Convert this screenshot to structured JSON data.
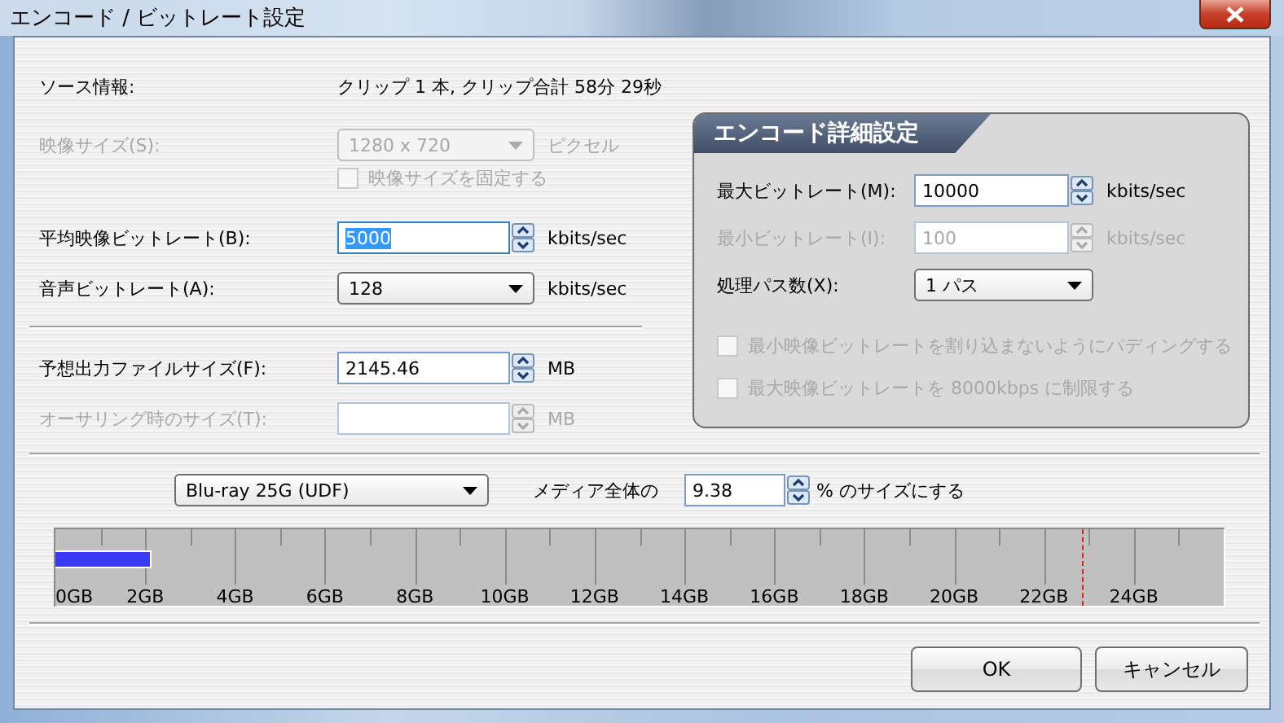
{
  "window": {
    "title": "エンコード / ビットレート設定"
  },
  "source_info": {
    "label": "ソース情報:",
    "value": "クリップ 1 本, クリップ合計 58分 29秒"
  },
  "fields": [
    {
      "kind": "combo",
      "label": "映像サイズ(S):",
      "value": "1280 x 720",
      "unit": "ピクセル",
      "disabled": true
    },
    {
      "kind": "checkbox",
      "label": "映像サイズを固定する",
      "checked": false,
      "disabled": true
    },
    {
      "kind": "spin",
      "label": "平均映像ビットレート(B):",
      "value": "5000",
      "unit": "kbits/sec",
      "disabled": false,
      "focused": true
    },
    {
      "kind": "combo",
      "label": "音声ビットレート(A):",
      "value": "128",
      "unit": "kbits/sec",
      "disabled": false
    },
    {
      "kind": "separator"
    },
    {
      "kind": "spin",
      "label": "予想出力ファイルサイズ(F):",
      "value": "2145.46",
      "unit": "MB",
      "disabled": false,
      "focused": false
    },
    {
      "kind": "spin",
      "label": "オーサリング時のサイズ(T):",
      "unit": "MB",
      "disabled": true,
      "focused": false
    }
  ],
  "advanced": {
    "title": "エンコード詳細設定",
    "fields": [
      {
        "kind": "spin",
        "label": "最大ビットレート(M):",
        "value": "10000",
        "unit": "kbits/sec",
        "disabled": false,
        "focused": false
      },
      {
        "kind": "spin",
        "label": "最小ビットレート(I):",
        "value": "100",
        "unit": "kbits/sec",
        "disabled": true,
        "focused": false
      },
      {
        "kind": "combo",
        "label": "処理パス数(X):",
        "value": "1 パス",
        "disabled": false
      },
      {
        "kind": "checkbox",
        "label": "最小映像ビットレートを割り込まないようにパディングする",
        "checked": false,
        "disabled": true
      },
      {
        "kind": "checkbox",
        "label": "最大映像ビットレートを 8000kbps に制限する",
        "checked": false,
        "disabled": true
      }
    ]
  },
  "media": {
    "disc": "Blu-ray 25G (UDF)",
    "ratio_label": "メディア全体の",
    "ratio_value": "9.38",
    "ratio_unit": "% のサイズにする"
  },
  "usage_bar": {
    "level": 0.082,
    "capacity_marker": {
      "level": 0.879
    },
    "tick_labels": [
      "0GB",
      "2GB",
      "4GB",
      "6GB",
      "8GB",
      "10GB",
      "12GB",
      "14GB",
      "16GB",
      "18GB",
      "20GB",
      "22GB",
      "24GB"
    ]
  },
  "buttons": [
    {
      "label": "OK"
    },
    {
      "label": "キャンセル"
    }
  ]
}
